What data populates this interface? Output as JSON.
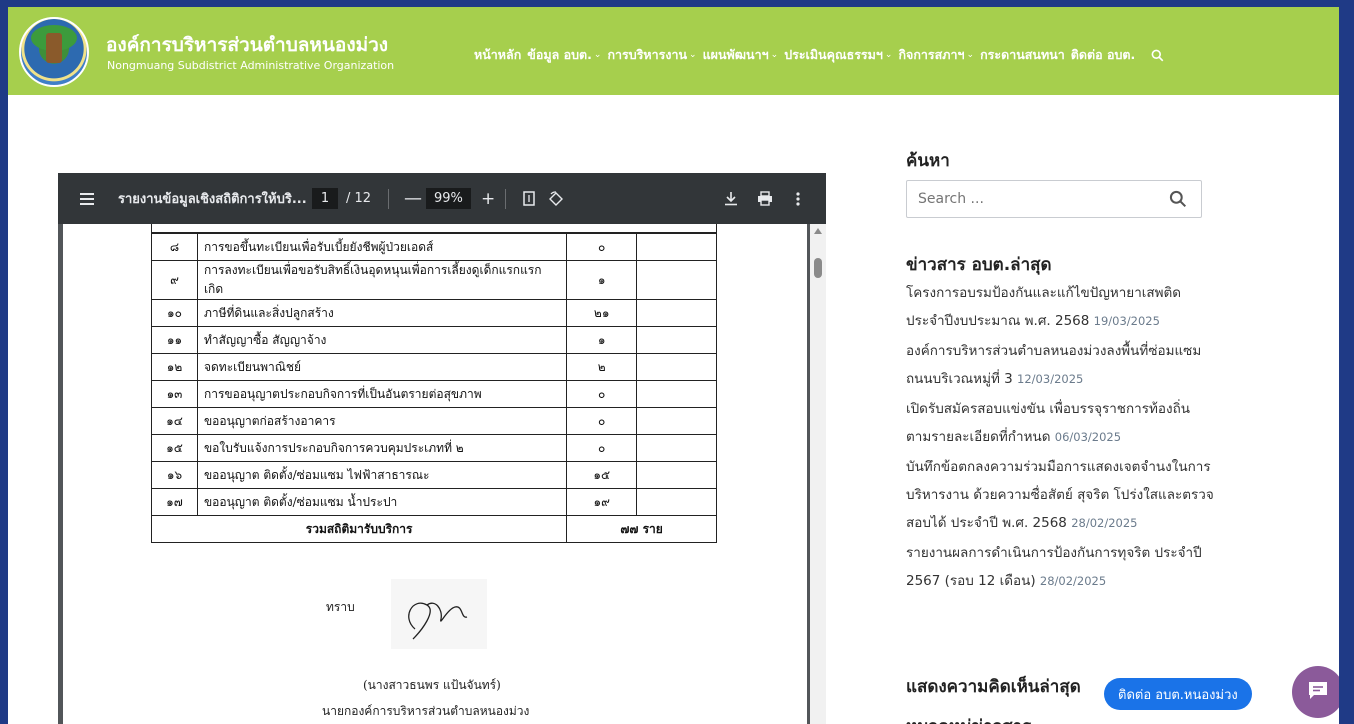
{
  "site": {
    "title": "องค์การบริหารส่วนตำบลหนองม่วง",
    "subtitle": "Nongmuang Subdistrict Administrative Organization"
  },
  "nav": {
    "items": [
      {
        "label": "หน้าหลัก",
        "dropdown": false
      },
      {
        "label": "ข้อมูล อบต.",
        "dropdown": true
      },
      {
        "label": "การบริหารงาน",
        "dropdown": true
      },
      {
        "label": "แผนพัฒนาฯ",
        "dropdown": true
      },
      {
        "label": "ประเมินคุณธรรมฯ",
        "dropdown": true
      },
      {
        "label": "กิจการสภาฯ",
        "dropdown": true
      },
      {
        "label": "กระดานสนทนา",
        "dropdown": false
      },
      {
        "label": "ติดต่อ อบต.",
        "dropdown": false
      }
    ]
  },
  "pdf": {
    "doc_title": "รายงานข้อมูลเชิงสถิติการให้บริ...",
    "page_current": "1",
    "page_total": "/ 12",
    "zoom": "99%",
    "rows": [
      {
        "no": "๘",
        "name": "การขอขึ้นทะเบียนเพื่อรับเบี้ยยังชีพผู้ป่วยเอดส์",
        "count": "๐"
      },
      {
        "no": "๙",
        "name": "การลงทะเบียนเพื่อขอรับสิทธิ์เงินอุดหนุนเพื่อการเลี้ยงดูเด็กแรกแรกเกิด",
        "count": "๑"
      },
      {
        "no": "๑๐",
        "name": "ภาษีที่ดินและสิ่งปลูกสร้าง",
        "count": "๒๑"
      },
      {
        "no": "๑๑",
        "name": "ทำสัญญาซื้อ  สัญญาจ้าง",
        "count": "๑"
      },
      {
        "no": "๑๒",
        "name": "จดทะเบียนพาณิชย์",
        "count": "๒"
      },
      {
        "no": "๑๓",
        "name": "การขออนุญาตประกอบกิจการที่เป็นอันตรายต่อสุขภาพ",
        "count": "๐"
      },
      {
        "no": "๑๔",
        "name": "ขออนุญาตก่อสร้างอาคาร",
        "count": "๐"
      },
      {
        "no": "๑๕",
        "name": "ขอใบรับแจ้งการประกอบกิจการควบคุมประเภทที่ ๒",
        "count": "๐"
      },
      {
        "no": "๑๖",
        "name": "ขออนุญาต ติดตั้ง/ซ่อมแซม ไฟฟ้าสาธารณะ",
        "count": "๑๕"
      },
      {
        "no": "๑๗",
        "name": "ขออนุญาต ติดตั้ง/ซ่อมแซม น้ำประปา",
        "count": "๑๙"
      }
    ],
    "total_label": "รวมสถิติมารับบริการ",
    "total_value": "๗๗  ราย",
    "ack": "ทราบ",
    "signer_name": "(นางสาวธนพร  แป้นจันทร์)",
    "signer_position": "นายกองค์การบริหารส่วนตำบลหนองม่วง"
  },
  "sidebar": {
    "search_heading": "ค้นหา",
    "search_placeholder": "Search ...",
    "news_heading": "ข่าวสาร อบต.ล่าสุด",
    "news": [
      {
        "title": "โครงการอบรมป้องกันและแก้ไขปัญหายาเสพติด ประจำปีงบประมาณ พ.ศ. 2568",
        "date": "19/03/2025"
      },
      {
        "title": "องค์การบริหารส่วนตำบลหนองม่วงลงพื้นที่ซ่อมแซมถนนบริเวณหมู่ที่ 3",
        "date": "12/03/2025"
      },
      {
        "title": "เปิดรับสมัครสอบแข่งขัน เพื่อบรรจุราชการท้องถิ่น ตามรายละเอียดที่กำหนด",
        "date": "06/03/2025"
      },
      {
        "title": "บันทึกข้อตกลงความร่วมมือการแสดงเจตจำนงในการบริหารงาน ด้วยความซื่อสัตย์ สุจริต โปร่งใสและตรวจสอบได้ ประจำปี พ.ศ. 2568",
        "date": "28/02/2025"
      },
      {
        "title": "รายงานผลการดำเนินการป้องกันการทุจริต ประจำปี 2567 (รอบ 12 เดือน)",
        "date": "28/02/2025"
      }
    ],
    "comments_heading": "แสดงความคิดเห็นล่าสุด",
    "next_heading": "หมวดหมู่ข่าวสาร"
  },
  "chat": {
    "label": "ติดต่อ อบต.หนองม่วง"
  },
  "colors": {
    "header": "#a6cf4d",
    "border": "#1f3a86",
    "pdf_toolbar": "#323639",
    "chat_label": "#1a73e8",
    "chat_button": "#8b5a9a"
  },
  "icons": {
    "menu": "hamburger-icon",
    "download": "download-icon",
    "print": "print-icon",
    "more": "more-vert-icon",
    "fit": "fit-page-icon",
    "rotate": "rotate-icon",
    "search": "search-icon",
    "chat": "chat-icon"
  }
}
